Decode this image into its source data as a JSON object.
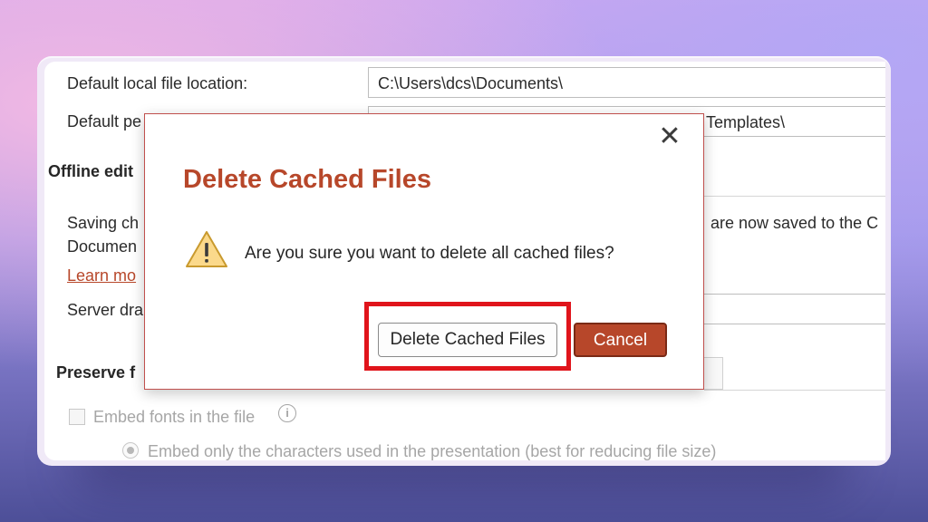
{
  "settings": {
    "local_location_label": "Default local file location:",
    "local_location_value": "C:\\Users\\dcs\\Documents\\",
    "personal_templates_label_visible": "Default pe",
    "personal_templates_value_visible": "Templates\\",
    "offline_heading_visible": "Offline edit",
    "saving_text_line1_visible": "Saving ch",
    "saving_text_line1_right_visible": "are now saved to the C",
    "saving_text_line2_visible": "Documen",
    "learn_more_visible": "Learn mo",
    "server_drafts_label_visible": "Server dra",
    "preserve_heading_visible": "Preserve f",
    "embed_fonts_label": "Embed fonts in the file",
    "embed_only_label": "Embed only the characters used in the presentation (best for reducing file size)"
  },
  "dialog": {
    "title": "Delete Cached Files",
    "message": "Are you sure you want to delete all cached files?",
    "confirm_label": "Delete Cached Files",
    "cancel_label": "Cancel",
    "close_glyph": "✕",
    "icon": "warning-icon"
  },
  "colors": {
    "accent": "#b7472a",
    "highlight_border": "#e0141b"
  }
}
